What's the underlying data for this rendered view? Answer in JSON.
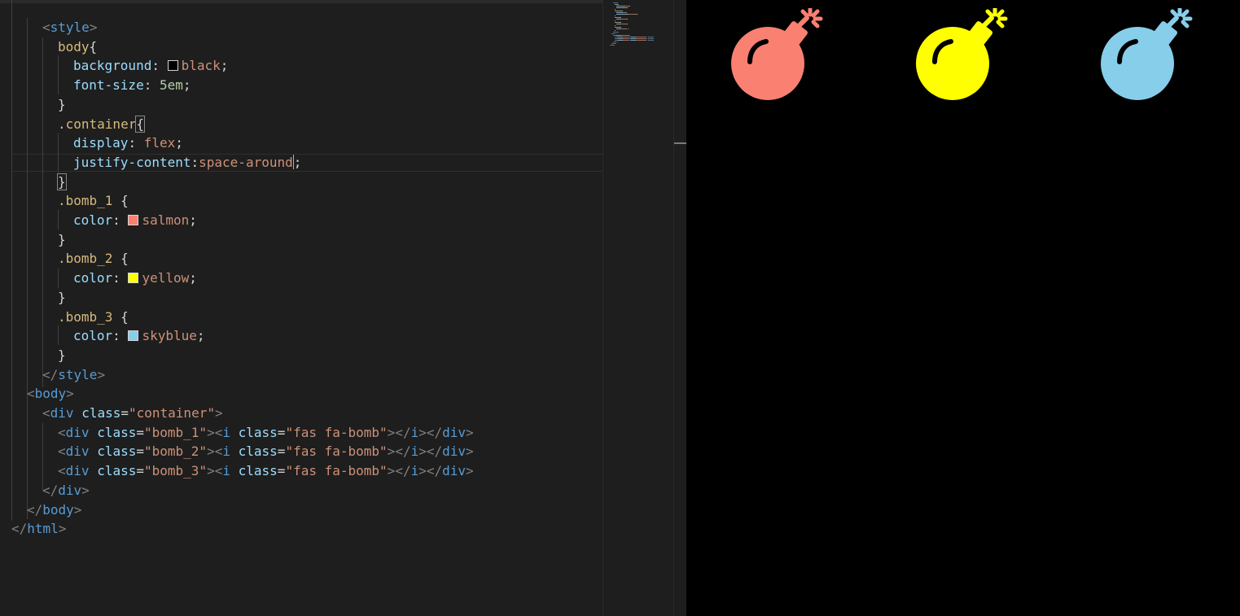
{
  "editor": {
    "lines": [
      {
        "i": 2,
        "parts": [
          [
            "tag-p",
            "<"
          ],
          [
            "tag",
            "style"
          ],
          [
            "tag-p",
            ">"
          ]
        ]
      },
      {
        "i": 3,
        "parts": [
          [
            "sel",
            "body"
          ],
          [
            "",
            "{"
          ]
        ]
      },
      {
        "i": 4,
        "parts": [
          [
            "prop",
            "background"
          ],
          [
            "",
            ": "
          ],
          [
            "swatch",
            "#000000"
          ],
          [
            "val",
            "black"
          ],
          [
            "",
            ";"
          ]
        ]
      },
      {
        "i": 4,
        "parts": [
          [
            "prop",
            "font-size"
          ],
          [
            "",
            ": "
          ],
          [
            "num",
            "5em"
          ],
          [
            "",
            ";"
          ]
        ]
      },
      {
        "i": 3,
        "parts": [
          [
            "",
            "}"
          ]
        ]
      },
      {
        "i": 3,
        "parts": [
          [
            "sel",
            ".container"
          ],
          [
            "hl",
            "{"
          ]
        ]
      },
      {
        "i": 4,
        "parts": [
          [
            "prop",
            "display"
          ],
          [
            "",
            ": "
          ],
          [
            "val",
            "flex"
          ],
          [
            "",
            ";"
          ]
        ]
      },
      {
        "i": 4,
        "parts": [
          [
            "prop",
            "justify-content"
          ],
          [
            "",
            ":"
          ],
          [
            "val",
            "space-around"
          ],
          [
            "caret",
            ""
          ],
          [
            "",
            ";"
          ]
        ]
      },
      {
        "i": 3,
        "parts": [
          [
            "hl",
            "}"
          ]
        ]
      },
      {
        "i": 3,
        "parts": [
          [
            "sel",
            ".bomb_1"
          ],
          [
            "",
            " {"
          ]
        ]
      },
      {
        "i": 4,
        "parts": [
          [
            "prop",
            "color"
          ],
          [
            "",
            ": "
          ],
          [
            "swatch",
            "#fa8072"
          ],
          [
            "val",
            "salmon"
          ],
          [
            "",
            ";"
          ]
        ]
      },
      {
        "i": 3,
        "parts": [
          [
            "",
            "}"
          ]
        ]
      },
      {
        "i": 3,
        "parts": [
          [
            "sel",
            ".bomb_2"
          ],
          [
            "",
            " {"
          ]
        ]
      },
      {
        "i": 4,
        "parts": [
          [
            "prop",
            "color"
          ],
          [
            "",
            ": "
          ],
          [
            "swatch",
            "#ffff00"
          ],
          [
            "val",
            "yellow"
          ],
          [
            "",
            ";"
          ]
        ]
      },
      {
        "i": 3,
        "parts": [
          [
            "",
            "}"
          ]
        ]
      },
      {
        "i": 3,
        "parts": [
          [
            "sel",
            ".bomb_3"
          ],
          [
            "",
            " {"
          ]
        ]
      },
      {
        "i": 4,
        "parts": [
          [
            "prop",
            "color"
          ],
          [
            "",
            ": "
          ],
          [
            "swatch",
            "#87ceeb"
          ],
          [
            "val",
            "skyblue"
          ],
          [
            "",
            ";"
          ]
        ]
      },
      {
        "i": 3,
        "parts": [
          [
            "",
            "}"
          ]
        ]
      },
      {
        "i": 2,
        "parts": [
          [
            "tag-p",
            "</"
          ],
          [
            "tag",
            "style"
          ],
          [
            "tag-p",
            ">"
          ]
        ]
      },
      {
        "i": 1,
        "parts": [
          [
            "tag-p",
            "<"
          ],
          [
            "tag",
            "body"
          ],
          [
            "tag-p",
            ">"
          ]
        ]
      },
      {
        "i": 2,
        "parts": [
          [
            "tag-p",
            "<"
          ],
          [
            "tag",
            "div"
          ],
          [
            "",
            " "
          ],
          [
            "attr",
            "class"
          ],
          [
            "",
            "="
          ],
          [
            "str",
            "\"container\""
          ],
          [
            "tag-p",
            ">"
          ]
        ]
      },
      {
        "i": 3,
        "parts": [
          [
            "tag-p",
            "<"
          ],
          [
            "tag",
            "div"
          ],
          [
            "",
            " "
          ],
          [
            "attr",
            "class"
          ],
          [
            "",
            "="
          ],
          [
            "str",
            "\"bomb_1\""
          ],
          [
            "tag-p",
            ">"
          ],
          [
            "tag-p",
            "<"
          ],
          [
            "tag",
            "i"
          ],
          [
            "",
            " "
          ],
          [
            "attr",
            "class"
          ],
          [
            "",
            "="
          ],
          [
            "str",
            "\"fas fa-bomb\""
          ],
          [
            "tag-p",
            ">"
          ],
          [
            "tag-p",
            "</"
          ],
          [
            "tag",
            "i"
          ],
          [
            "tag-p",
            ">"
          ],
          [
            "tag-p",
            "</"
          ],
          [
            "tag",
            "div"
          ],
          [
            "tag-p",
            ">"
          ]
        ]
      },
      {
        "i": 3,
        "parts": [
          [
            "tag-p",
            "<"
          ],
          [
            "tag",
            "div"
          ],
          [
            "",
            " "
          ],
          [
            "attr",
            "class"
          ],
          [
            "",
            "="
          ],
          [
            "str",
            "\"bomb_2\""
          ],
          [
            "tag-p",
            ">"
          ],
          [
            "tag-p",
            "<"
          ],
          [
            "tag",
            "i"
          ],
          [
            "",
            " "
          ],
          [
            "attr",
            "class"
          ],
          [
            "",
            "="
          ],
          [
            "str",
            "\"fas fa-bomb\""
          ],
          [
            "tag-p",
            ">"
          ],
          [
            "tag-p",
            "</"
          ],
          [
            "tag",
            "i"
          ],
          [
            "tag-p",
            ">"
          ],
          [
            "tag-p",
            "</"
          ],
          [
            "tag",
            "div"
          ],
          [
            "tag-p",
            ">"
          ]
        ]
      },
      {
        "i": 3,
        "parts": [
          [
            "tag-p",
            "<"
          ],
          [
            "tag",
            "div"
          ],
          [
            "",
            " "
          ],
          [
            "attr",
            "class"
          ],
          [
            "",
            "="
          ],
          [
            "str",
            "\"bomb_3\""
          ],
          [
            "tag-p",
            ">"
          ],
          [
            "tag-p",
            "<"
          ],
          [
            "tag",
            "i"
          ],
          [
            "",
            " "
          ],
          [
            "attr",
            "class"
          ],
          [
            "",
            "="
          ],
          [
            "str",
            "\"fas fa-bomb\""
          ],
          [
            "tag-p",
            ">"
          ],
          [
            "tag-p",
            "</"
          ],
          [
            "tag",
            "i"
          ],
          [
            "tag-p",
            ">"
          ],
          [
            "tag-p",
            "</"
          ],
          [
            "tag",
            "div"
          ],
          [
            "tag-p",
            ">"
          ]
        ]
      },
      {
        "i": 2,
        "parts": [
          [
            "tag-p",
            "</"
          ],
          [
            "tag",
            "div"
          ],
          [
            "tag-p",
            ">"
          ]
        ]
      },
      {
        "i": 1,
        "parts": [
          [
            "tag-p",
            "</"
          ],
          [
            "tag",
            "body"
          ],
          [
            "tag-p",
            ">"
          ]
        ]
      },
      {
        "i": 0,
        "parts": [
          [
            "tag-p",
            "</"
          ],
          [
            "tag",
            "html"
          ],
          [
            "tag-p",
            ">"
          ]
        ]
      }
    ]
  },
  "preview": {
    "background": "#000000",
    "bombs": [
      {
        "name": "bomb-1-icon",
        "color": "#fa8072"
      },
      {
        "name": "bomb-2-icon",
        "color": "#ffff00"
      },
      {
        "name": "bomb-3-icon",
        "color": "#87ceeb"
      }
    ]
  }
}
